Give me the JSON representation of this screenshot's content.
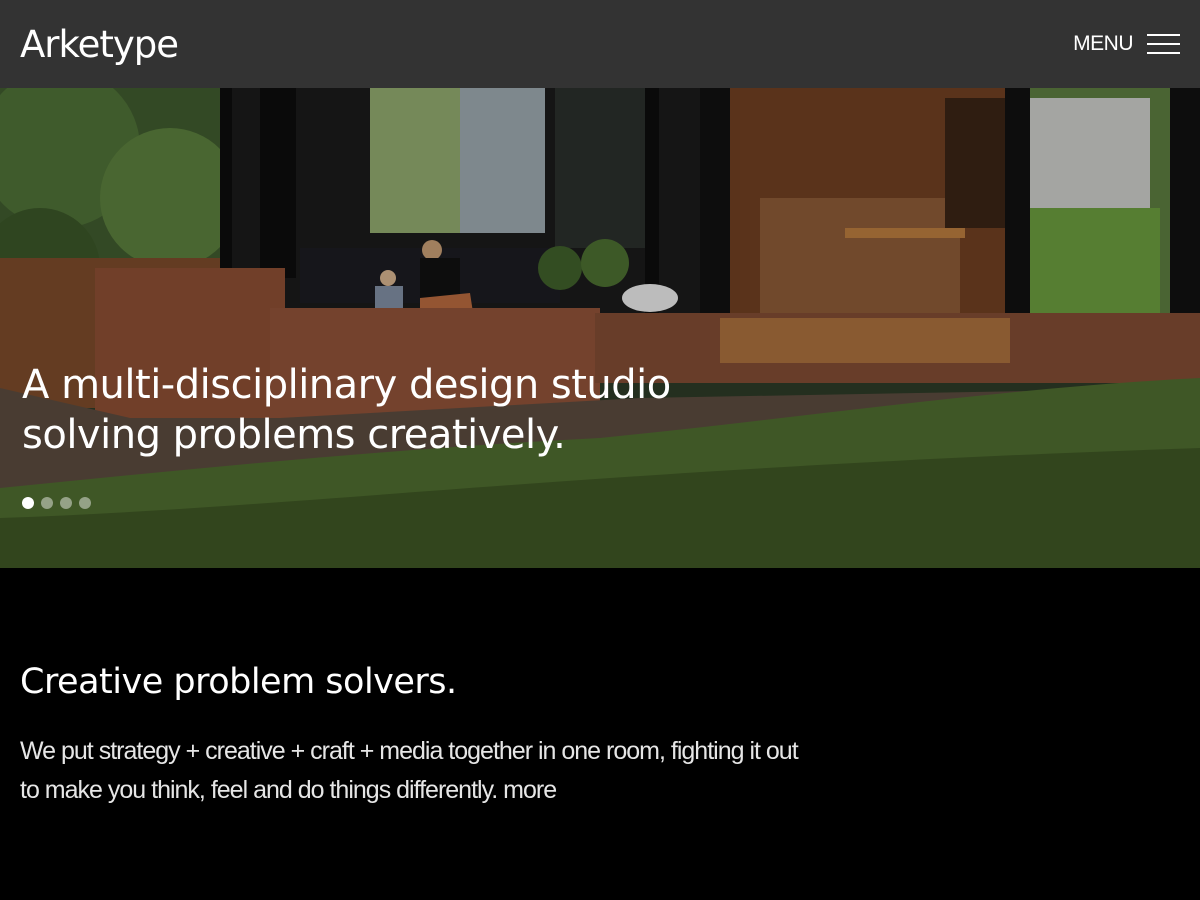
{
  "header": {
    "logo": "Arketype",
    "menu_label": "MENU"
  },
  "hero": {
    "headline_line1": "A multi-disciplinary design studio",
    "headline_line2": "solving problems creatively.",
    "slides_count": 4,
    "active_slide": 1,
    "image_description_icon": "house-garden-photo"
  },
  "intro": {
    "title": "Creative problem solvers.",
    "body": "We put strategy + creative + craft + media together in one room, fighting it out to make you think, feel and do things differently.",
    "more_link": "more"
  }
}
